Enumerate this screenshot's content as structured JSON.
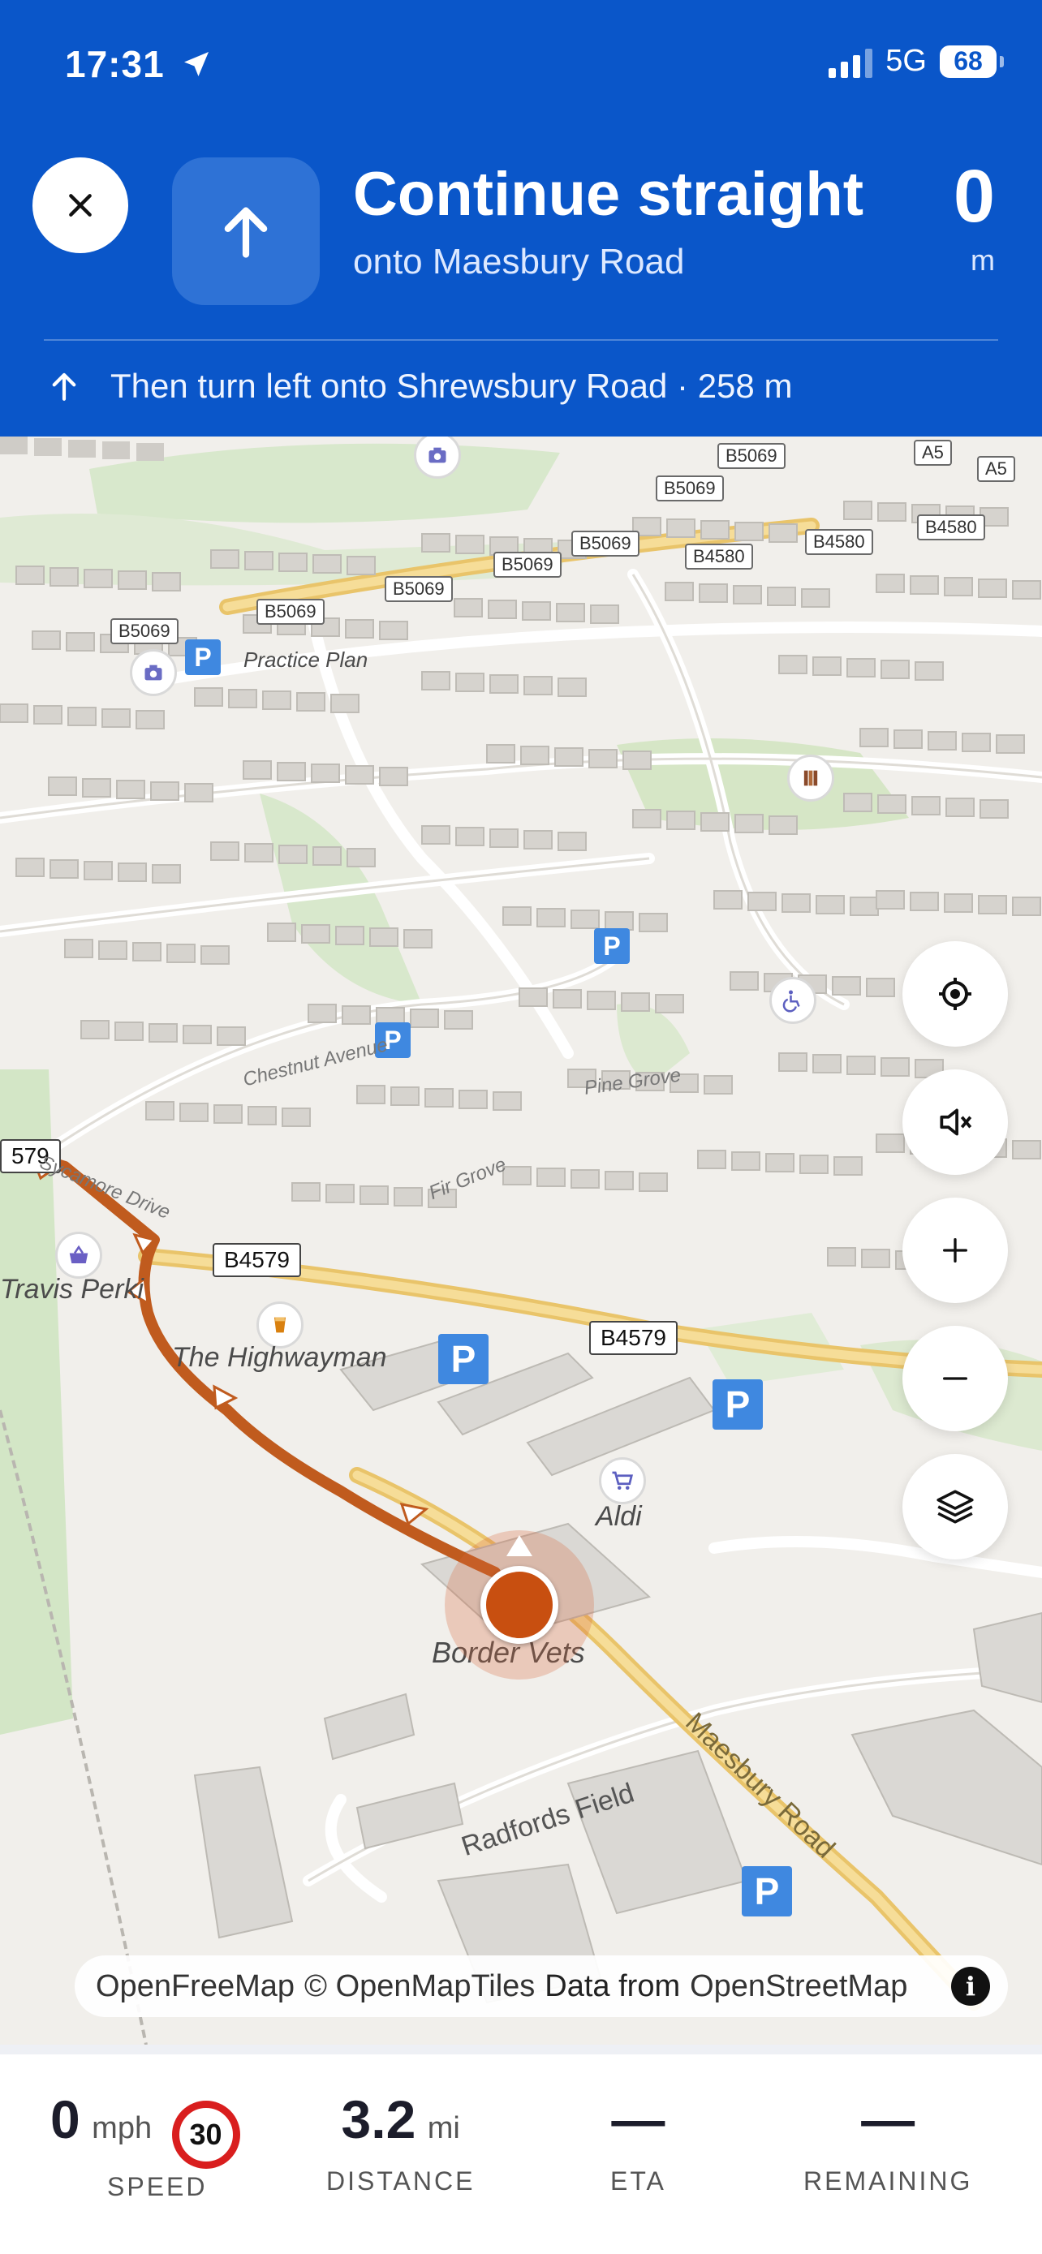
{
  "status_bar": {
    "time": "17:31",
    "network": "5G",
    "battery": "68"
  },
  "instruction": {
    "main": "Continue straight",
    "sub": "onto Maesbury Road",
    "distance_value": "0",
    "distance_unit": "m",
    "next": "Then turn left onto Shrewsbury Road · 258 m"
  },
  "map": {
    "road_shields": [
      "B5069",
      "B5069",
      "B5069",
      "B5069",
      "B5069",
      "B5069",
      "B5069",
      "B4580",
      "B4580",
      "B4580",
      "A5",
      "A5",
      "B4579",
      "B4579",
      "579"
    ],
    "labels": {
      "practice_plan": "Practice Plan",
      "travis_perkins": "Travis Perki",
      "highwayman": "The Highwayman",
      "aldi": "Aldi",
      "border_vets": "Border Vets",
      "maesbury_road": "Maesbury Road",
      "radfords_field": "Radfords Field",
      "sycamore_drive": "Sycamore Drive",
      "fir_grove": "Fir Grove",
      "pine_grove": "Pine Grove",
      "chestnut_avenue": "Chestnut Avenue"
    },
    "parking_label": "P",
    "attribution": {
      "openfreemap": "OpenFreeMap",
      "openmaptiles": "© OpenMapTiles",
      "data_from": "Data from",
      "openstreetmap": "OpenStreetMap",
      "info": "i"
    }
  },
  "bottom_bar": {
    "speed_value": "0",
    "speed_unit": "mph",
    "speed_limit": "30",
    "speed_label": "SPEED",
    "distance_value": "3.2",
    "distance_unit": "mi",
    "distance_label": "DISTANCE",
    "eta_value": "—",
    "eta_label": "ETA",
    "remaining_value": "—",
    "remaining_label": "REMAINING"
  },
  "colors": {
    "banner": "#0a56c9",
    "route": "#c05b1e",
    "user": "#c84f10",
    "speed_limit_ring": "#d91e1e"
  }
}
